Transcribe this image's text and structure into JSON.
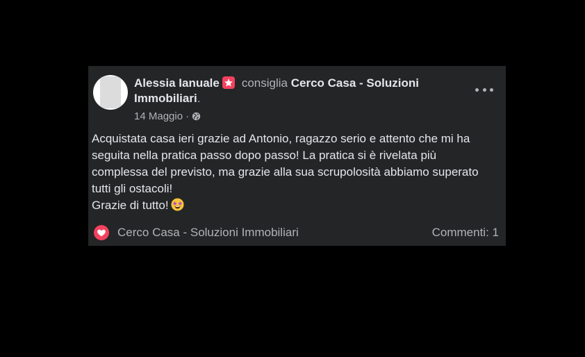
{
  "post": {
    "author_name": "Alessia Ianuale",
    "author_badge_icon": "star-badge-icon",
    "action_text": "consiglia",
    "page_name": "Cerco Casa - Soluzioni Immobiliari",
    "page_suffix": ".",
    "date": "14 Maggio",
    "separator": "·",
    "privacy_icon": "globe-icon",
    "menu_icon": "more-options-icon",
    "body_lines": [
      "Acquistata casa ieri grazie ad Antonio, ragazzo serio e attento che mi ha seguita nella pratica passo dopo passo! La pratica si è rivelata più complessa del previsto, ma grazie alla sua scrupolosità abbiamo superato tutti gli ostacoli!",
      "Grazie di tutto!"
    ],
    "closing_emoji": "star-struck-emoji"
  },
  "footer": {
    "reaction_icon": "heart-icon",
    "page_name": "Cerco Casa - Soluzioni Immobiliari",
    "comments": "Commenti: 1"
  },
  "colors": {
    "background": "#000000",
    "card": "#242526",
    "primary_text": "#e4e6eb",
    "secondary_text": "#b0b3b8",
    "accent": "#f3425f"
  }
}
